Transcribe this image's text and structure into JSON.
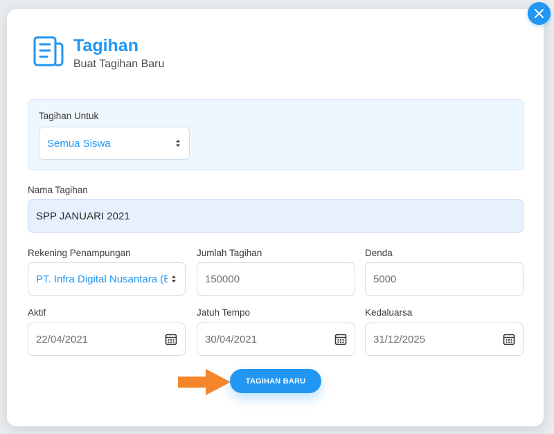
{
  "header": {
    "title": "Tagihan",
    "subtitle": "Buat Tagihan Baru",
    "icon": "document-icon"
  },
  "form": {
    "tagihan_untuk": {
      "label": "Tagihan Untuk",
      "value": "Semua Siswa"
    },
    "nama_tagihan": {
      "label": "Nama Tagihan",
      "value": "SPP JANUARI 2021"
    },
    "rekening": {
      "label": "Rekening Penampungan",
      "value": "PT. Infra Digital Nusantara (BA"
    },
    "jumlah": {
      "label": "Jumlah Tagihan",
      "placeholder": "150000"
    },
    "denda": {
      "label": "Denda",
      "placeholder": "5000"
    },
    "aktif": {
      "label": "Aktif",
      "value": "22/04/2021"
    },
    "jatuh_tempo": {
      "label": "Jatuh Tempo",
      "value": "30/04/2021"
    },
    "kedaluarsa": {
      "label": "Kedaluarsa",
      "value": "31/12/2025"
    }
  },
  "actions": {
    "submit_label": "TAGIHAN BARU"
  },
  "colors": {
    "accent": "#2196f3",
    "arrow": "#f5862b",
    "panel": "#eef6fe"
  }
}
